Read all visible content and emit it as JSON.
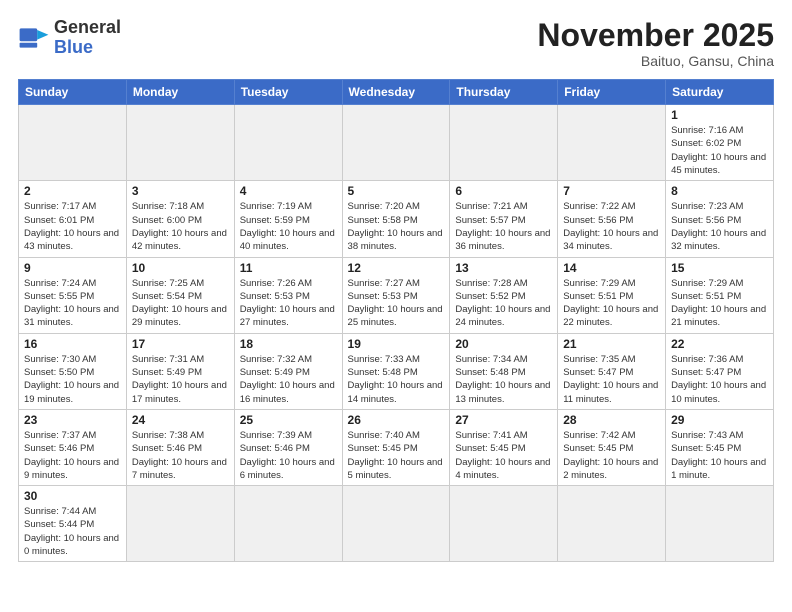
{
  "header": {
    "logo_general": "General",
    "logo_blue": "Blue",
    "month_title": "November 2025",
    "location": "Baituo, Gansu, China"
  },
  "weekdays": [
    "Sunday",
    "Monday",
    "Tuesday",
    "Wednesday",
    "Thursday",
    "Friday",
    "Saturday"
  ],
  "weeks": [
    [
      {
        "day": "",
        "empty": true
      },
      {
        "day": "",
        "empty": true
      },
      {
        "day": "",
        "empty": true
      },
      {
        "day": "",
        "empty": true
      },
      {
        "day": "",
        "empty": true
      },
      {
        "day": "",
        "empty": true
      },
      {
        "day": "1",
        "sunrise": "Sunrise: 7:16 AM",
        "sunset": "Sunset: 6:02 PM",
        "daylight": "Daylight: 10 hours and 45 minutes."
      }
    ],
    [
      {
        "day": "2",
        "sunrise": "Sunrise: 7:17 AM",
        "sunset": "Sunset: 6:01 PM",
        "daylight": "Daylight: 10 hours and 43 minutes."
      },
      {
        "day": "3",
        "sunrise": "Sunrise: 7:18 AM",
        "sunset": "Sunset: 6:00 PM",
        "daylight": "Daylight: 10 hours and 42 minutes."
      },
      {
        "day": "4",
        "sunrise": "Sunrise: 7:19 AM",
        "sunset": "Sunset: 5:59 PM",
        "daylight": "Daylight: 10 hours and 40 minutes."
      },
      {
        "day": "5",
        "sunrise": "Sunrise: 7:20 AM",
        "sunset": "Sunset: 5:58 PM",
        "daylight": "Daylight: 10 hours and 38 minutes."
      },
      {
        "day": "6",
        "sunrise": "Sunrise: 7:21 AM",
        "sunset": "Sunset: 5:57 PM",
        "daylight": "Daylight: 10 hours and 36 minutes."
      },
      {
        "day": "7",
        "sunrise": "Sunrise: 7:22 AM",
        "sunset": "Sunset: 5:56 PM",
        "daylight": "Daylight: 10 hours and 34 minutes."
      },
      {
        "day": "8",
        "sunrise": "Sunrise: 7:23 AM",
        "sunset": "Sunset: 5:56 PM",
        "daylight": "Daylight: 10 hours and 32 minutes."
      }
    ],
    [
      {
        "day": "9",
        "sunrise": "Sunrise: 7:24 AM",
        "sunset": "Sunset: 5:55 PM",
        "daylight": "Daylight: 10 hours and 31 minutes."
      },
      {
        "day": "10",
        "sunrise": "Sunrise: 7:25 AM",
        "sunset": "Sunset: 5:54 PM",
        "daylight": "Daylight: 10 hours and 29 minutes."
      },
      {
        "day": "11",
        "sunrise": "Sunrise: 7:26 AM",
        "sunset": "Sunset: 5:53 PM",
        "daylight": "Daylight: 10 hours and 27 minutes."
      },
      {
        "day": "12",
        "sunrise": "Sunrise: 7:27 AM",
        "sunset": "Sunset: 5:53 PM",
        "daylight": "Daylight: 10 hours and 25 minutes."
      },
      {
        "day": "13",
        "sunrise": "Sunrise: 7:28 AM",
        "sunset": "Sunset: 5:52 PM",
        "daylight": "Daylight: 10 hours and 24 minutes."
      },
      {
        "day": "14",
        "sunrise": "Sunrise: 7:29 AM",
        "sunset": "Sunset: 5:51 PM",
        "daylight": "Daylight: 10 hours and 22 minutes."
      },
      {
        "day": "15",
        "sunrise": "Sunrise: 7:29 AM",
        "sunset": "Sunset: 5:51 PM",
        "daylight": "Daylight: 10 hours and 21 minutes."
      }
    ],
    [
      {
        "day": "16",
        "sunrise": "Sunrise: 7:30 AM",
        "sunset": "Sunset: 5:50 PM",
        "daylight": "Daylight: 10 hours and 19 minutes."
      },
      {
        "day": "17",
        "sunrise": "Sunrise: 7:31 AM",
        "sunset": "Sunset: 5:49 PM",
        "daylight": "Daylight: 10 hours and 17 minutes."
      },
      {
        "day": "18",
        "sunrise": "Sunrise: 7:32 AM",
        "sunset": "Sunset: 5:49 PM",
        "daylight": "Daylight: 10 hours and 16 minutes."
      },
      {
        "day": "19",
        "sunrise": "Sunrise: 7:33 AM",
        "sunset": "Sunset: 5:48 PM",
        "daylight": "Daylight: 10 hours and 14 minutes."
      },
      {
        "day": "20",
        "sunrise": "Sunrise: 7:34 AM",
        "sunset": "Sunset: 5:48 PM",
        "daylight": "Daylight: 10 hours and 13 minutes."
      },
      {
        "day": "21",
        "sunrise": "Sunrise: 7:35 AM",
        "sunset": "Sunset: 5:47 PM",
        "daylight": "Daylight: 10 hours and 11 minutes."
      },
      {
        "day": "22",
        "sunrise": "Sunrise: 7:36 AM",
        "sunset": "Sunset: 5:47 PM",
        "daylight": "Daylight: 10 hours and 10 minutes."
      }
    ],
    [
      {
        "day": "23",
        "sunrise": "Sunrise: 7:37 AM",
        "sunset": "Sunset: 5:46 PM",
        "daylight": "Daylight: 10 hours and 9 minutes."
      },
      {
        "day": "24",
        "sunrise": "Sunrise: 7:38 AM",
        "sunset": "Sunset: 5:46 PM",
        "daylight": "Daylight: 10 hours and 7 minutes."
      },
      {
        "day": "25",
        "sunrise": "Sunrise: 7:39 AM",
        "sunset": "Sunset: 5:46 PM",
        "daylight": "Daylight: 10 hours and 6 minutes."
      },
      {
        "day": "26",
        "sunrise": "Sunrise: 7:40 AM",
        "sunset": "Sunset: 5:45 PM",
        "daylight": "Daylight: 10 hours and 5 minutes."
      },
      {
        "day": "27",
        "sunrise": "Sunrise: 7:41 AM",
        "sunset": "Sunset: 5:45 PM",
        "daylight": "Daylight: 10 hours and 4 minutes."
      },
      {
        "day": "28",
        "sunrise": "Sunrise: 7:42 AM",
        "sunset": "Sunset: 5:45 PM",
        "daylight": "Daylight: 10 hours and 2 minutes."
      },
      {
        "day": "29",
        "sunrise": "Sunrise: 7:43 AM",
        "sunset": "Sunset: 5:45 PM",
        "daylight": "Daylight: 10 hours and 1 minute."
      }
    ],
    [
      {
        "day": "30",
        "sunrise": "Sunrise: 7:44 AM",
        "sunset": "Sunset: 5:44 PM",
        "daylight": "Daylight: 10 hours and 0 minutes."
      },
      {
        "day": "",
        "empty": true
      },
      {
        "day": "",
        "empty": true
      },
      {
        "day": "",
        "empty": true
      },
      {
        "day": "",
        "empty": true
      },
      {
        "day": "",
        "empty": true
      },
      {
        "day": "",
        "empty": true
      }
    ]
  ]
}
